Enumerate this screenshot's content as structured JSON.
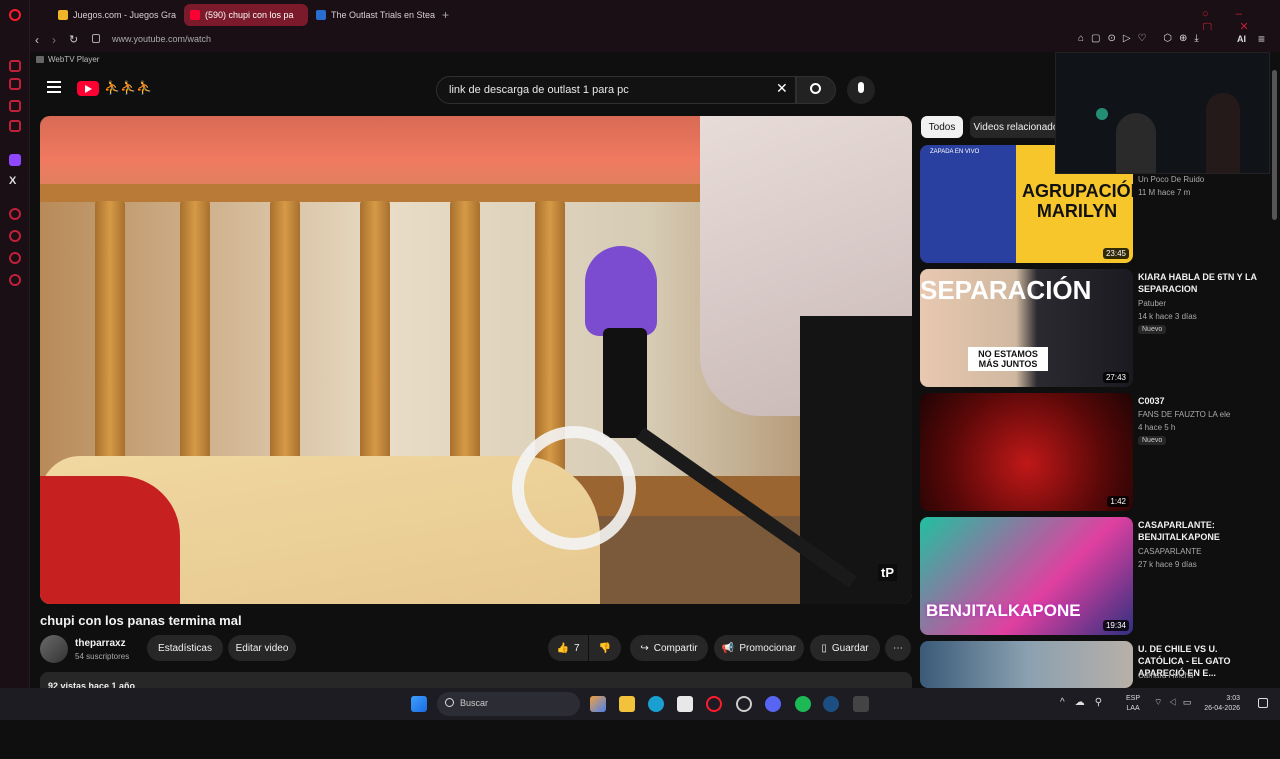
{
  "browser": {
    "tabs": [
      {
        "label": "Juegos.com - Juegos Gra",
        "color": "#f0b429"
      },
      {
        "label": "(590) chupi con los pa",
        "color": "#ff0033"
      },
      {
        "label": "The Outlast Trials en Stea",
        "color": "#2a6dd1"
      }
    ],
    "url": "www.youtube.com/watch",
    "bookmark": "WebTV Player",
    "toolbar_ai": "AI"
  },
  "youtube": {
    "search_query": "link de descarga de outlast 1 para pc",
    "video": {
      "title": "chupi con los panas termina mal",
      "channel": "theparraxz",
      "subscribers": "54 suscriptores",
      "stats_button": "Estadísticas",
      "edit_button": "Editar video",
      "likes": "7",
      "share": "Compartir",
      "promote": "Promocionar",
      "save": "Guardar",
      "description": "92 vistas  hace 1 año",
      "watermark": "tP"
    },
    "chips": [
      "Todos",
      "Videos relacionado"
    ],
    "recommendations": [
      {
        "thumb_text": "AGRUPACIÓN MARILYN",
        "thumb_top": "ZAPADA EN VIVO",
        "title": "",
        "channel": "Un Poco De Ruido",
        "meta": "11 M  hace 7 m",
        "duration": "23:45",
        "new": ""
      },
      {
        "thumb_text": "SEPARACIÓN",
        "thumb_sub": "NO ESTAMOS MÁS JUNTOS",
        "title": "KIARA HABLA DE 6TN Y LA SEPARACION",
        "channel": "Patuber",
        "meta": "14 k  hace 3 días",
        "duration": "27:43",
        "new": "Nuevo"
      },
      {
        "title": "C0037",
        "channel": "FANS DE FAUZTO LA ele",
        "meta": "4  hace 5 h",
        "duration": "1:42",
        "new": "Nuevo"
      },
      {
        "thumb_text": "BENJITALKAPONE",
        "title": "CASAPARLANTE: BENJITALKAPONE",
        "channel": "CASAPARLANTE",
        "meta": "27 k  hace 9 días",
        "duration": "19:34",
        "new": ""
      },
      {
        "title": "U. DE CHILE VS U. CATÓLICA - EL GATO APARECIÓ EN E...",
        "channel": "Camara Hincha",
        "meta": "",
        "duration": "",
        "new": ""
      }
    ]
  },
  "taskbar": {
    "search": "Buscar",
    "lang": "ESP",
    "lang2": "LAA",
    "time": "3:03",
    "date": "26-04-2026"
  },
  "colors": {
    "yt_red": "#ff0033",
    "opera_red": "#ff1b2d"
  }
}
